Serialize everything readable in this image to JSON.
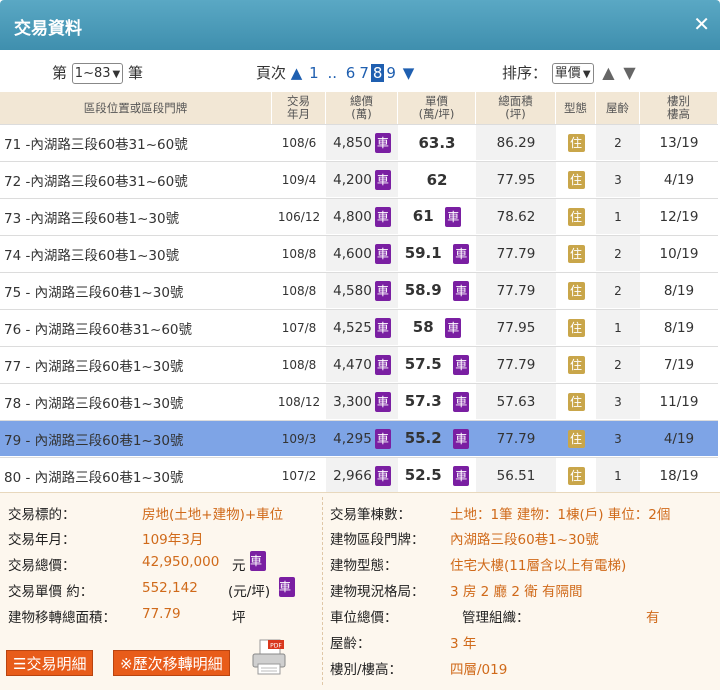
{
  "title": "交易資料",
  "close_icon": "close-icon",
  "toolbar": {
    "prefix": "第",
    "range_select": "1~83",
    "suffix": "筆",
    "page_label": "頁次",
    "page_links": [
      "1",
      "..",
      "6",
      "7",
      "8",
      "9"
    ],
    "current_page": "8",
    "sort_label": "排序：",
    "sort_select": "單價"
  },
  "table": {
    "headers": {
      "address": "區段位置或區段門牌",
      "date": "交易\n年月",
      "total": "總價\n(萬)",
      "unit": "單價\n(萬/坪)",
      "area": "總面積\n(坪)",
      "type": "型態",
      "age": "屋齡",
      "floor": "樓別\n樓高"
    },
    "badge_che": "車",
    "badge_zhu": "住",
    "rows": [
      {
        "no": "71",
        "address": "-內湖路三段60巷31~60號",
        "date": "108/6",
        "total": "4,850",
        "total_che": true,
        "unit": "63.3",
        "unit_che": false,
        "area": "86.29",
        "age": "2",
        "floor": "13/19"
      },
      {
        "no": "72",
        "address": "-內湖路三段60巷31~60號",
        "date": "109/4",
        "total": "4,200",
        "total_che": true,
        "unit": "62",
        "unit_che": false,
        "area": "77.95",
        "age": "3",
        "floor": "4/19"
      },
      {
        "no": "73",
        "address": "-內湖路三段60巷1~30號",
        "date": "106/12",
        "total": "4,800",
        "total_che": true,
        "unit": "61",
        "unit_che": true,
        "area": "78.62",
        "age": "1",
        "floor": "12/19"
      },
      {
        "no": "74",
        "address": "-內湖路三段60巷1~30號",
        "date": "108/8",
        "total": "4,600",
        "total_che": true,
        "unit": "59.1",
        "unit_che": true,
        "area": "77.79",
        "age": "2",
        "floor": "10/19"
      },
      {
        "no": "75",
        "address": "- 內湖路三段60巷1~30號",
        "date": "108/8",
        "total": "4,580",
        "total_che": true,
        "unit": "58.9",
        "unit_che": true,
        "area": "77.79",
        "age": "2",
        "floor": "8/19"
      },
      {
        "no": "76",
        "address": "- 內湖路三段60巷31~60號",
        "date": "107/8",
        "total": "4,525",
        "total_che": true,
        "unit": "58",
        "unit_che": true,
        "area": "77.95",
        "age": "1",
        "floor": "8/19"
      },
      {
        "no": "77",
        "address": "- 內湖路三段60巷1~30號",
        "date": "108/8",
        "total": "4,470",
        "total_che": true,
        "unit": "57.5",
        "unit_che": true,
        "area": "77.79",
        "age": "2",
        "floor": "7/19"
      },
      {
        "no": "78",
        "address": "- 內湖路三段60巷1~30號",
        "date": "108/12",
        "total": "3,300",
        "total_che": true,
        "unit": "57.3",
        "unit_che": true,
        "area": "57.63",
        "age": "3",
        "floor": "11/19"
      },
      {
        "no": "79",
        "address": "- 內湖路三段60巷1~30號",
        "date": "109/3",
        "total": "4,295",
        "total_che": true,
        "unit": "55.2",
        "unit_che": true,
        "area": "77.79",
        "age": "3",
        "floor": "4/19",
        "selected": true
      },
      {
        "no": "80",
        "address": "- 內湖路三段60巷1~30號",
        "date": "107/2",
        "total": "2,966",
        "total_che": true,
        "unit": "52.5",
        "unit_che": true,
        "area": "56.51",
        "age": "1",
        "floor": "18/19"
      }
    ]
  },
  "detail": {
    "target_label": "交易標的：",
    "target_value": "房地(土地+建物)+車位",
    "ym_label": "交易年月：",
    "ym_value": "109年3月",
    "total_label": "交易總價：",
    "total_value": "42,950,000",
    "total_unit": "元",
    "unit_label": "交易單價 約：",
    "unit_value": "552,142",
    "unit_unit": "(元/坪)",
    "area_label": "建物移轉總面積：",
    "area_value": "77.79",
    "area_unit": "坪",
    "count_label": "交易筆棟數：",
    "count_value": "土地：1筆 建物：1棟(戶) 車位：2個",
    "addr_label": "建物區段門牌：",
    "addr_value": "內湖路三段60巷1~30號",
    "btype_label": "建物型態：",
    "btype_value": "住宅大樓(11層含以上有電梯)",
    "layout_label": "建物現況格局：",
    "layout_value": "3 房 2 廳 2 衛 有隔間",
    "parking_label": "車位總價：",
    "mgmt_label": "管理組織：",
    "mgmt_value": "有",
    "age_label": "屋齡：",
    "age_value": "3 年",
    "floor_label": "樓別/樓高：",
    "floor_value": "四層/019",
    "btn_detail": "交易明細",
    "btn_history": "※歷次移轉明細",
    "pdf_icon": "pdf-printer-icon",
    "pdf_text": "PDF"
  }
}
